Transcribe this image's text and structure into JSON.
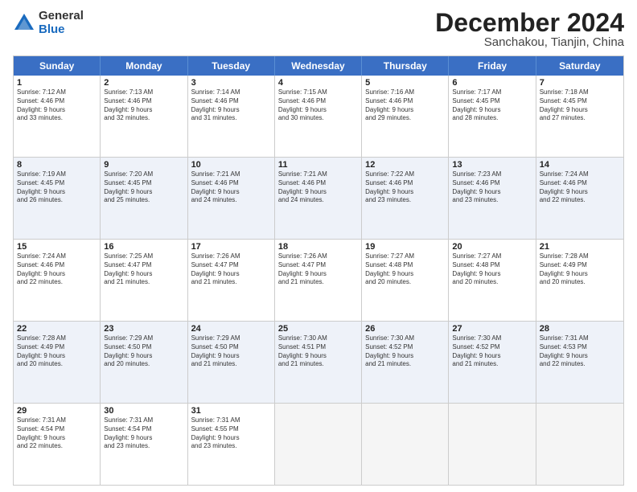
{
  "logo": {
    "general": "General",
    "blue": "Blue"
  },
  "title": {
    "month": "December 2024",
    "location": "Sanchakou, Tianjin, China"
  },
  "calendar": {
    "headers": [
      "Sunday",
      "Monday",
      "Tuesday",
      "Wednesday",
      "Thursday",
      "Friday",
      "Saturday"
    ],
    "rows": [
      [
        {
          "day": "1",
          "rise": "Sunrise: 7:12 AM",
          "set": "Sunset: 4:46 PM",
          "day_label": "Daylight: 9 hours",
          "minutes": "and 33 minutes."
        },
        {
          "day": "2",
          "rise": "Sunrise: 7:13 AM",
          "set": "Sunset: 4:46 PM",
          "day_label": "Daylight: 9 hours",
          "minutes": "and 32 minutes."
        },
        {
          "day": "3",
          "rise": "Sunrise: 7:14 AM",
          "set": "Sunset: 4:46 PM",
          "day_label": "Daylight: 9 hours",
          "minutes": "and 31 minutes."
        },
        {
          "day": "4",
          "rise": "Sunrise: 7:15 AM",
          "set": "Sunset: 4:46 PM",
          "day_label": "Daylight: 9 hours",
          "minutes": "and 30 minutes."
        },
        {
          "day": "5",
          "rise": "Sunrise: 7:16 AM",
          "set": "Sunset: 4:46 PM",
          "day_label": "Daylight: 9 hours",
          "minutes": "and 29 minutes."
        },
        {
          "day": "6",
          "rise": "Sunrise: 7:17 AM",
          "set": "Sunset: 4:45 PM",
          "day_label": "Daylight: 9 hours",
          "minutes": "and 28 minutes."
        },
        {
          "day": "7",
          "rise": "Sunrise: 7:18 AM",
          "set": "Sunset: 4:45 PM",
          "day_label": "Daylight: 9 hours",
          "minutes": "and 27 minutes."
        }
      ],
      [
        {
          "day": "8",
          "rise": "Sunrise: 7:19 AM",
          "set": "Sunset: 4:45 PM",
          "day_label": "Daylight: 9 hours",
          "minutes": "and 26 minutes."
        },
        {
          "day": "9",
          "rise": "Sunrise: 7:20 AM",
          "set": "Sunset: 4:45 PM",
          "day_label": "Daylight: 9 hours",
          "minutes": "and 25 minutes."
        },
        {
          "day": "10",
          "rise": "Sunrise: 7:21 AM",
          "set": "Sunset: 4:46 PM",
          "day_label": "Daylight: 9 hours",
          "minutes": "and 24 minutes."
        },
        {
          "day": "11",
          "rise": "Sunrise: 7:21 AM",
          "set": "Sunset: 4:46 PM",
          "day_label": "Daylight: 9 hours",
          "minutes": "and 24 minutes."
        },
        {
          "day": "12",
          "rise": "Sunrise: 7:22 AM",
          "set": "Sunset: 4:46 PM",
          "day_label": "Daylight: 9 hours",
          "minutes": "and 23 minutes."
        },
        {
          "day": "13",
          "rise": "Sunrise: 7:23 AM",
          "set": "Sunset: 4:46 PM",
          "day_label": "Daylight: 9 hours",
          "minutes": "and 23 minutes."
        },
        {
          "day": "14",
          "rise": "Sunrise: 7:24 AM",
          "set": "Sunset: 4:46 PM",
          "day_label": "Daylight: 9 hours",
          "minutes": "and 22 minutes."
        }
      ],
      [
        {
          "day": "15",
          "rise": "Sunrise: 7:24 AM",
          "set": "Sunset: 4:46 PM",
          "day_label": "Daylight: 9 hours",
          "minutes": "and 22 minutes."
        },
        {
          "day": "16",
          "rise": "Sunrise: 7:25 AM",
          "set": "Sunset: 4:47 PM",
          "day_label": "Daylight: 9 hours",
          "minutes": "and 21 minutes."
        },
        {
          "day": "17",
          "rise": "Sunrise: 7:26 AM",
          "set": "Sunset: 4:47 PM",
          "day_label": "Daylight: 9 hours",
          "minutes": "and 21 minutes."
        },
        {
          "day": "18",
          "rise": "Sunrise: 7:26 AM",
          "set": "Sunset: 4:47 PM",
          "day_label": "Daylight: 9 hours",
          "minutes": "and 21 minutes."
        },
        {
          "day": "19",
          "rise": "Sunrise: 7:27 AM",
          "set": "Sunset: 4:48 PM",
          "day_label": "Daylight: 9 hours",
          "minutes": "and 20 minutes."
        },
        {
          "day": "20",
          "rise": "Sunrise: 7:27 AM",
          "set": "Sunset: 4:48 PM",
          "day_label": "Daylight: 9 hours",
          "minutes": "and 20 minutes."
        },
        {
          "day": "21",
          "rise": "Sunrise: 7:28 AM",
          "set": "Sunset: 4:49 PM",
          "day_label": "Daylight: 9 hours",
          "minutes": "and 20 minutes."
        }
      ],
      [
        {
          "day": "22",
          "rise": "Sunrise: 7:28 AM",
          "set": "Sunset: 4:49 PM",
          "day_label": "Daylight: 9 hours",
          "minutes": "and 20 minutes."
        },
        {
          "day": "23",
          "rise": "Sunrise: 7:29 AM",
          "set": "Sunset: 4:50 PM",
          "day_label": "Daylight: 9 hours",
          "minutes": "and 20 minutes."
        },
        {
          "day": "24",
          "rise": "Sunrise: 7:29 AM",
          "set": "Sunset: 4:50 PM",
          "day_label": "Daylight: 9 hours",
          "minutes": "and 21 minutes."
        },
        {
          "day": "25",
          "rise": "Sunrise: 7:30 AM",
          "set": "Sunset: 4:51 PM",
          "day_label": "Daylight: 9 hours",
          "minutes": "and 21 minutes."
        },
        {
          "day": "26",
          "rise": "Sunrise: 7:30 AM",
          "set": "Sunset: 4:52 PM",
          "day_label": "Daylight: 9 hours",
          "minutes": "and 21 minutes."
        },
        {
          "day": "27",
          "rise": "Sunrise: 7:30 AM",
          "set": "Sunset: 4:52 PM",
          "day_label": "Daylight: 9 hours",
          "minutes": "and 21 minutes."
        },
        {
          "day": "28",
          "rise": "Sunrise: 7:31 AM",
          "set": "Sunset: 4:53 PM",
          "day_label": "Daylight: 9 hours",
          "minutes": "and 22 minutes."
        }
      ],
      [
        {
          "day": "29",
          "rise": "Sunrise: 7:31 AM",
          "set": "Sunset: 4:54 PM",
          "day_label": "Daylight: 9 hours",
          "minutes": "and 22 minutes."
        },
        {
          "day": "30",
          "rise": "Sunrise: 7:31 AM",
          "set": "Sunset: 4:54 PM",
          "day_label": "Daylight: 9 hours",
          "minutes": "and 23 minutes."
        },
        {
          "day": "31",
          "rise": "Sunrise: 7:31 AM",
          "set": "Sunset: 4:55 PM",
          "day_label": "Daylight: 9 hours",
          "minutes": "and 23 minutes."
        },
        null,
        null,
        null,
        null
      ]
    ]
  }
}
